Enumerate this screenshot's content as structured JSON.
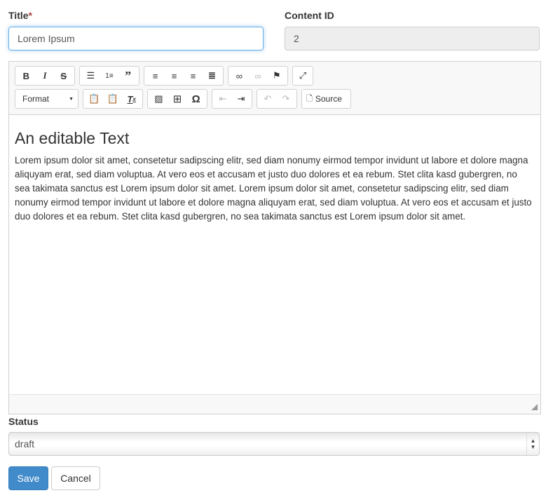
{
  "form": {
    "title_label": "Title",
    "required_mark": "*",
    "title_value": "Lorem Ipsum",
    "content_id_label": "Content ID",
    "content_id_value": "2",
    "status_label": "Status",
    "status_value": "draft",
    "save_label": "Save",
    "cancel_label": "Cancel"
  },
  "editor": {
    "toolbar": {
      "format_label": "Format",
      "source_label": "Source"
    },
    "heading": "An editable Text",
    "body": "Lorem ipsum dolor sit amet, consetetur sadipscing elitr, sed diam nonumy eirmod tempor invidunt ut labore et dolore magna aliquyam erat, sed diam voluptua. At vero eos et accusam et justo duo dolores et ea rebum. Stet clita kasd gubergren, no sea takimata sanctus est Lorem ipsum dolor sit amet. Lorem ipsum dolor sit amet, consetetur sadipscing elitr, sed diam nonumy eirmod tempor invidunt ut labore et dolore magna aliquyam erat, sed diam voluptua. At vero eos et accusam et justo duo dolores et ea rebum. Stet clita kasd gubergren, no sea takimata sanctus est Lorem ipsum dolor sit amet."
  },
  "colors": {
    "primary": "#428bca",
    "required": "#a94442",
    "focus": "#66afe9"
  }
}
